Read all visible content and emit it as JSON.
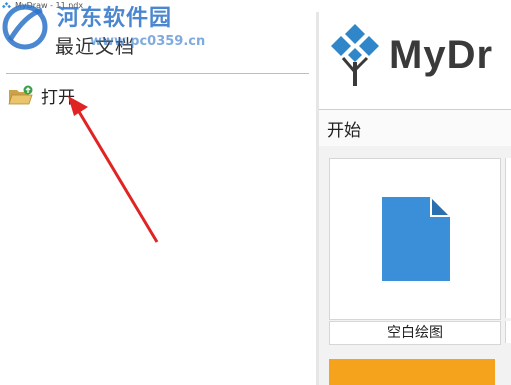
{
  "window": {
    "title": "MyDraw - 11.ndx"
  },
  "watermark": {
    "site_name": "河东软件园",
    "url": "www.pc0359.cn"
  },
  "left_pane": {
    "header": "最近文档",
    "open_label": "打开"
  },
  "right_pane": {
    "brand_name": "MyDr",
    "start_label": "开始",
    "templates": [
      {
        "label": "空白绘图"
      }
    ]
  },
  "colors": {
    "accent_blue": "#3b8fd8",
    "brand_text": "#3a3a3a",
    "annotation_red": "#e02424",
    "template_orange": "#f5a21d"
  }
}
